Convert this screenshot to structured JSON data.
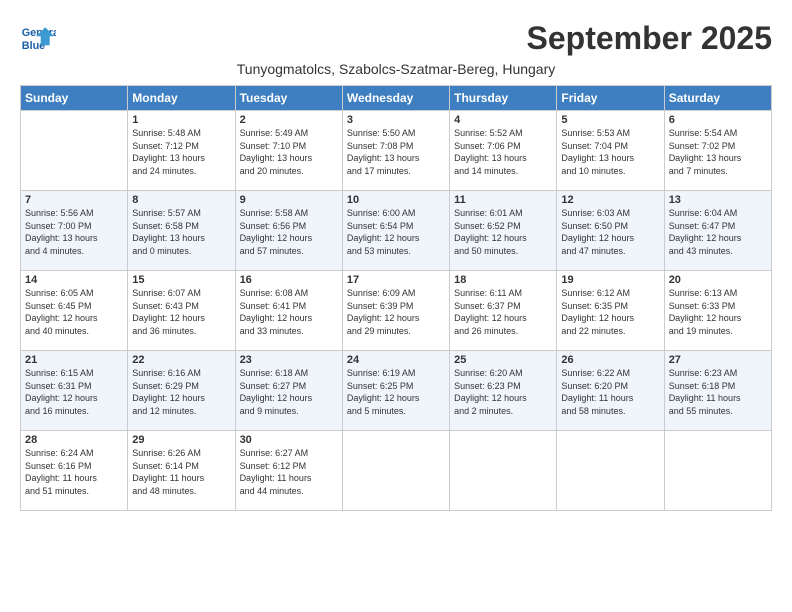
{
  "header": {
    "logo_line1": "General",
    "logo_line2": "Blue",
    "month": "September 2025",
    "location": "Tunyogmatolcs, Szabolcs-Szatmar-Bereg, Hungary"
  },
  "days_of_week": [
    "Sunday",
    "Monday",
    "Tuesday",
    "Wednesday",
    "Thursday",
    "Friday",
    "Saturday"
  ],
  "weeks": [
    [
      {
        "day": "",
        "info": ""
      },
      {
        "day": "1",
        "info": "Sunrise: 5:48 AM\nSunset: 7:12 PM\nDaylight: 13 hours\nand 24 minutes."
      },
      {
        "day": "2",
        "info": "Sunrise: 5:49 AM\nSunset: 7:10 PM\nDaylight: 13 hours\nand 20 minutes."
      },
      {
        "day": "3",
        "info": "Sunrise: 5:50 AM\nSunset: 7:08 PM\nDaylight: 13 hours\nand 17 minutes."
      },
      {
        "day": "4",
        "info": "Sunrise: 5:52 AM\nSunset: 7:06 PM\nDaylight: 13 hours\nand 14 minutes."
      },
      {
        "day": "5",
        "info": "Sunrise: 5:53 AM\nSunset: 7:04 PM\nDaylight: 13 hours\nand 10 minutes."
      },
      {
        "day": "6",
        "info": "Sunrise: 5:54 AM\nSunset: 7:02 PM\nDaylight: 13 hours\nand 7 minutes."
      }
    ],
    [
      {
        "day": "7",
        "info": "Sunrise: 5:56 AM\nSunset: 7:00 PM\nDaylight: 13 hours\nand 4 minutes."
      },
      {
        "day": "8",
        "info": "Sunrise: 5:57 AM\nSunset: 6:58 PM\nDaylight: 13 hours\nand 0 minutes."
      },
      {
        "day": "9",
        "info": "Sunrise: 5:58 AM\nSunset: 6:56 PM\nDaylight: 12 hours\nand 57 minutes."
      },
      {
        "day": "10",
        "info": "Sunrise: 6:00 AM\nSunset: 6:54 PM\nDaylight: 12 hours\nand 53 minutes."
      },
      {
        "day": "11",
        "info": "Sunrise: 6:01 AM\nSunset: 6:52 PM\nDaylight: 12 hours\nand 50 minutes."
      },
      {
        "day": "12",
        "info": "Sunrise: 6:03 AM\nSunset: 6:50 PM\nDaylight: 12 hours\nand 47 minutes."
      },
      {
        "day": "13",
        "info": "Sunrise: 6:04 AM\nSunset: 6:47 PM\nDaylight: 12 hours\nand 43 minutes."
      }
    ],
    [
      {
        "day": "14",
        "info": "Sunrise: 6:05 AM\nSunset: 6:45 PM\nDaylight: 12 hours\nand 40 minutes."
      },
      {
        "day": "15",
        "info": "Sunrise: 6:07 AM\nSunset: 6:43 PM\nDaylight: 12 hours\nand 36 minutes."
      },
      {
        "day": "16",
        "info": "Sunrise: 6:08 AM\nSunset: 6:41 PM\nDaylight: 12 hours\nand 33 minutes."
      },
      {
        "day": "17",
        "info": "Sunrise: 6:09 AM\nSunset: 6:39 PM\nDaylight: 12 hours\nand 29 minutes."
      },
      {
        "day": "18",
        "info": "Sunrise: 6:11 AM\nSunset: 6:37 PM\nDaylight: 12 hours\nand 26 minutes."
      },
      {
        "day": "19",
        "info": "Sunrise: 6:12 AM\nSunset: 6:35 PM\nDaylight: 12 hours\nand 22 minutes."
      },
      {
        "day": "20",
        "info": "Sunrise: 6:13 AM\nSunset: 6:33 PM\nDaylight: 12 hours\nand 19 minutes."
      }
    ],
    [
      {
        "day": "21",
        "info": "Sunrise: 6:15 AM\nSunset: 6:31 PM\nDaylight: 12 hours\nand 16 minutes."
      },
      {
        "day": "22",
        "info": "Sunrise: 6:16 AM\nSunset: 6:29 PM\nDaylight: 12 hours\nand 12 minutes."
      },
      {
        "day": "23",
        "info": "Sunrise: 6:18 AM\nSunset: 6:27 PM\nDaylight: 12 hours\nand 9 minutes."
      },
      {
        "day": "24",
        "info": "Sunrise: 6:19 AM\nSunset: 6:25 PM\nDaylight: 12 hours\nand 5 minutes."
      },
      {
        "day": "25",
        "info": "Sunrise: 6:20 AM\nSunset: 6:23 PM\nDaylight: 12 hours\nand 2 minutes."
      },
      {
        "day": "26",
        "info": "Sunrise: 6:22 AM\nSunset: 6:20 PM\nDaylight: 11 hours\nand 58 minutes."
      },
      {
        "day": "27",
        "info": "Sunrise: 6:23 AM\nSunset: 6:18 PM\nDaylight: 11 hours\nand 55 minutes."
      }
    ],
    [
      {
        "day": "28",
        "info": "Sunrise: 6:24 AM\nSunset: 6:16 PM\nDaylight: 11 hours\nand 51 minutes."
      },
      {
        "day": "29",
        "info": "Sunrise: 6:26 AM\nSunset: 6:14 PM\nDaylight: 11 hours\nand 48 minutes."
      },
      {
        "day": "30",
        "info": "Sunrise: 6:27 AM\nSunset: 6:12 PM\nDaylight: 11 hours\nand 44 minutes."
      },
      {
        "day": "",
        "info": ""
      },
      {
        "day": "",
        "info": ""
      },
      {
        "day": "",
        "info": ""
      },
      {
        "day": "",
        "info": ""
      }
    ]
  ]
}
